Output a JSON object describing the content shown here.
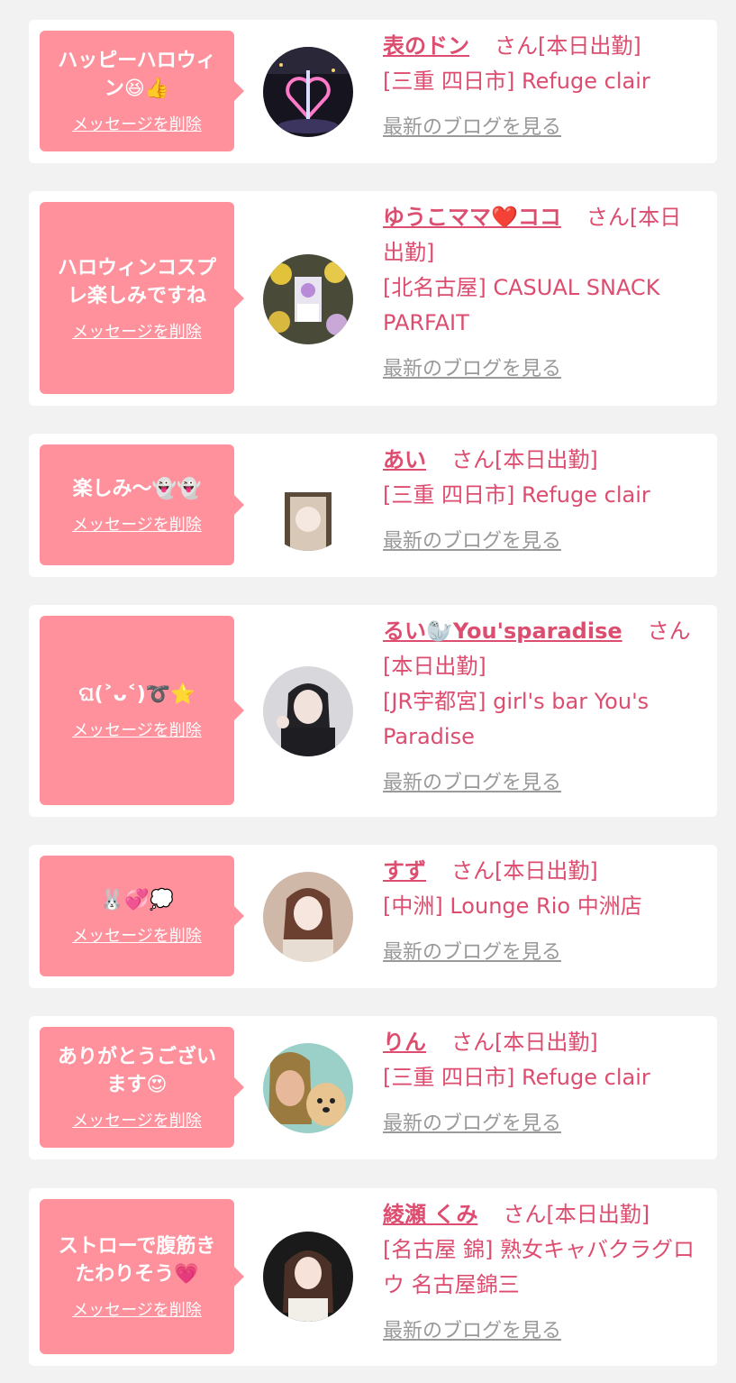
{
  "delete_label": "メッセージを削除",
  "blog_label": "最新のブログを見る",
  "cards": [
    {
      "message": "ハッピーハロウィ\nン😆👍",
      "name": "表のドン",
      "status": "さん[本日出勤]",
      "shop": "[三重 四日市] Refuge clair",
      "avatar_icon": "night-illumination-photo"
    },
    {
      "message": "ハロウィンコスプ\nレ楽しみですね",
      "name": "ゆうこママ❤️ココ",
      "status": "さん[本日出勤]",
      "shop": "[北名古屋] CASUAL SNACK PARFAIT",
      "avatar_icon": "flower-stand-photo"
    },
    {
      "message": "楽しみ〜👻👻",
      "name": "あい",
      "status": "さん[本日出勤]",
      "shop": "[三重 四日市] Refuge clair",
      "avatar_icon": "woman-portrait-photo"
    },
    {
      "message": "ଘ(˃ᴗ˂)➰⭐",
      "name": "るい🦭You'sparadise",
      "status": "さん[本日出勤]",
      "shop": "[JR宇都宮] girl's bar You's Paradise",
      "avatar_icon": "woman-peace-sign-photo"
    },
    {
      "message": "🐰💞💭",
      "name": "すず",
      "status": "さん[本日出勤]",
      "shop": "[中洲] Lounge Rio 中洲店",
      "avatar_icon": "woman-portrait-photo"
    },
    {
      "message": "ありがとうござい\nます😍",
      "name": "りん",
      "status": "さん[本日出勤]",
      "shop": "[三重 四日市] Refuge clair",
      "avatar_icon": "woman-with-puppy-photo"
    },
    {
      "message": "ストローで腹筋き\nたわりそう💗",
      "name": "綾瀬 くみ",
      "status": "さん[本日出勤]",
      "shop": "[名古屋 錦] 熟女キャバクラグロウ 名古屋錦三",
      "avatar_icon": "woman-portrait-photo"
    }
  ]
}
